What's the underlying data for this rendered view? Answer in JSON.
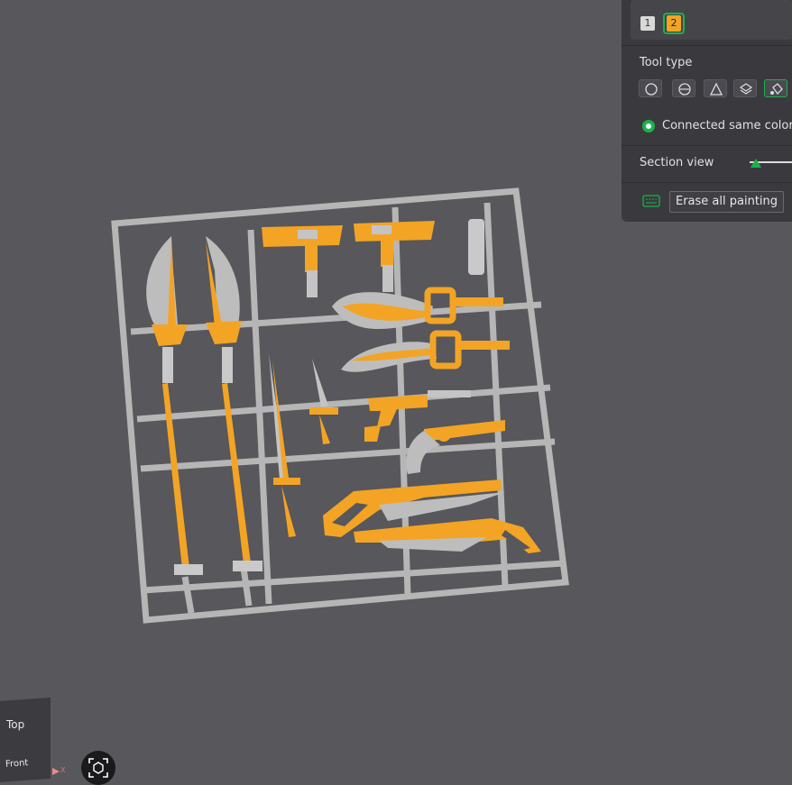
{
  "panel": {
    "filaments": [
      "1",
      "2"
    ],
    "selected_filament": "2",
    "tool_type_label": "Tool type",
    "tools": [
      "circle-tool",
      "sphere-tool",
      "triangle-tool",
      "height-range-tool",
      "fill-tool"
    ],
    "active_tool": "fill-tool",
    "connected_label": "Connected same color",
    "section_label": "Section view",
    "erase_label": "Erase all painting"
  },
  "view_cube": {
    "top_label": "Top",
    "front_label": "Front",
    "axis_x": "X"
  },
  "colors": {
    "background": "#57575c",
    "model_gray": "#b9b9b9",
    "paint_orange": "#f3a425",
    "accent_green": "#19b34b",
    "panel_bg": "#3a3a3e"
  }
}
